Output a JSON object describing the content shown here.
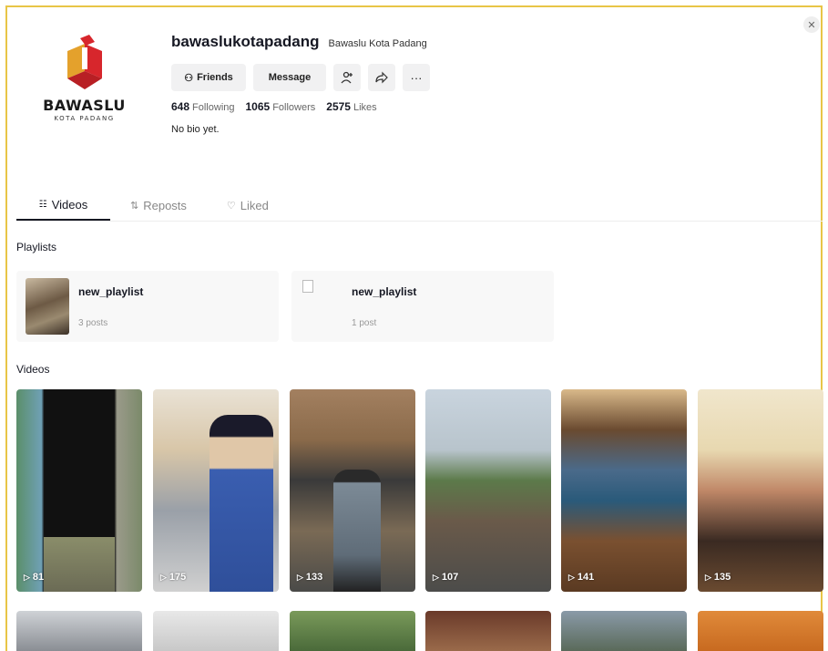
{
  "profile": {
    "username": "bawaslukotapadang",
    "nickname": "Bawaslu Kota Padang",
    "logo_text": "BAWASLU",
    "logo_subtext": "KOTA PADANG",
    "bio": "No bio yet.",
    "stats": [
      {
        "value": "648",
        "label": "Following"
      },
      {
        "value": "1065",
        "label": "Followers"
      },
      {
        "value": "2575",
        "label": "Likes"
      }
    ]
  },
  "actions": {
    "friends_label": "Friends",
    "message_label": "Message",
    "follow_icon": "person-add-icon",
    "share_icon": "share-icon",
    "more_icon": "more-icon"
  },
  "tabs": [
    {
      "label": "Videos",
      "icon": "grid-icon",
      "active": true
    },
    {
      "label": "Reposts",
      "icon": "repost-icon",
      "active": false
    },
    {
      "label": "Liked",
      "icon": "heart-icon",
      "active": false
    }
  ],
  "playlists_title": "Playlists",
  "playlists": [
    {
      "name": "new_playlist",
      "count": "3 posts"
    },
    {
      "name": "new_playlist",
      "count": "1 post"
    }
  ],
  "videos_title": "Videos",
  "videos": [
    {
      "views": "81"
    },
    {
      "views": "175"
    },
    {
      "views": "133"
    },
    {
      "views": "107"
    },
    {
      "views": "141"
    },
    {
      "views": "135"
    }
  ],
  "colors": {
    "accent": "#e8c547",
    "logo_red": "#d7262c",
    "logo_gold": "#e4a12c",
    "text": "#161823"
  }
}
